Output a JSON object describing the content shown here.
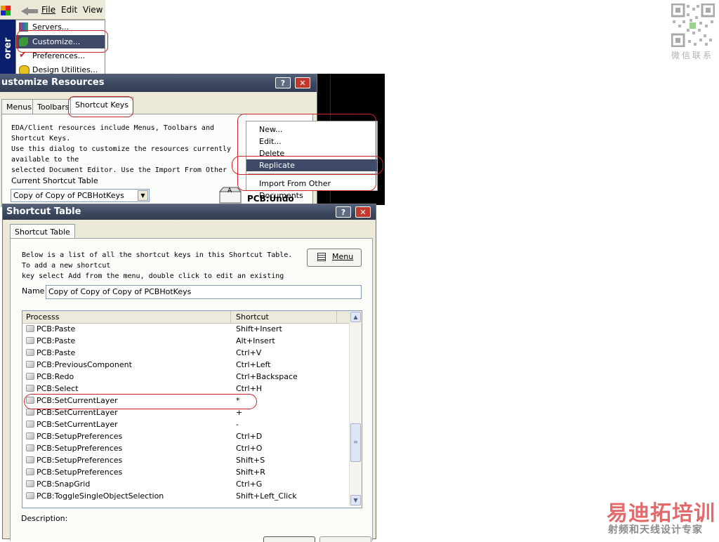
{
  "menubar": {
    "file": "File",
    "edit": "Edit",
    "view": "View"
  },
  "explorer_label": "orer",
  "file_menu": {
    "items": [
      {
        "label": "Servers..."
      },
      {
        "label": "Customize..."
      },
      {
        "label": "Preferences..."
      },
      {
        "label": "Design Utilities..."
      }
    ]
  },
  "customize_dialog": {
    "title": "ustomize Resources",
    "help": "?",
    "close": "✕",
    "tabs": [
      "Menus",
      "Toolbars",
      "Shortcut Keys"
    ],
    "description_lines": [
      "EDA/Client resources include Menus, Toolbars and",
      "Shortcut Keys.",
      "Use this dialog to customize the resources currently",
      "available to the",
      "selected Document Editor. Use the Import From Other"
    ],
    "table_label": "Current Shortcut Table",
    "table_value": "Copy of Copy of PCBHotKeys",
    "preview_key": "A",
    "preview_label": "PCB:Undo"
  },
  "context_menu": {
    "items": [
      "New...",
      "Edit...",
      "Delete",
      "Replicate",
      "Import From Other Documents"
    ]
  },
  "shortcut_dialog": {
    "title": "Shortcut Table",
    "help": "?",
    "close": "✕",
    "tab": "Shortcut Table",
    "intro_lines": [
      "Below is a list of all the shortcut keys in this Shortcut Table.",
      "To add a new shortcut",
      "key select Add from the menu, double click to edit an existing"
    ],
    "menu_button": "Menu",
    "name_label": "Name",
    "name_value": "Copy of Copy of Copy of PCBHotKeys",
    "columns": [
      "Processs",
      "Shortcut"
    ],
    "rows": [
      {
        "process": "PCB:Paste",
        "shortcut": "Shift+Insert"
      },
      {
        "process": "PCB:Paste",
        "shortcut": "Alt+Insert"
      },
      {
        "process": "PCB:Paste",
        "shortcut": "Ctrl+V"
      },
      {
        "process": "PCB:PreviousComponent",
        "shortcut": "Ctrl+Left"
      },
      {
        "process": "PCB:Redo",
        "shortcut": "Ctrl+Backspace"
      },
      {
        "process": "PCB:Select",
        "shortcut": "Ctrl+H"
      },
      {
        "process": "PCB:SetCurrentLayer",
        "shortcut": "*"
      },
      {
        "process": "PCB:SetCurrentLayer",
        "shortcut": "+"
      },
      {
        "process": "PCB:SetCurrentLayer",
        "shortcut": "-"
      },
      {
        "process": "PCB:SetupPreferences",
        "shortcut": "Ctrl+D"
      },
      {
        "process": "PCB:SetupPreferences",
        "shortcut": "Ctrl+O"
      },
      {
        "process": "PCB:SetupPreferences",
        "shortcut": "Shift+S"
      },
      {
        "process": "PCB:SetupPreferences",
        "shortcut": "Shift+R"
      },
      {
        "process": "PCB:SnapGrid",
        "shortcut": "Ctrl+G"
      },
      {
        "process": "PCB:ToggleSingleObjectSelection",
        "shortcut": "Shift+Left_Click"
      }
    ],
    "description_label": "Description:"
  },
  "watermark": {
    "qr_caption": "微信联系",
    "brand": "易迪拓培训",
    "tagline": "射频和天线设计专家"
  },
  "colors": {
    "highlight_ring": "#c8252a",
    "selection": "#3e4a68",
    "title_bar": "#3c4860",
    "brand": "#e26a6a"
  }
}
